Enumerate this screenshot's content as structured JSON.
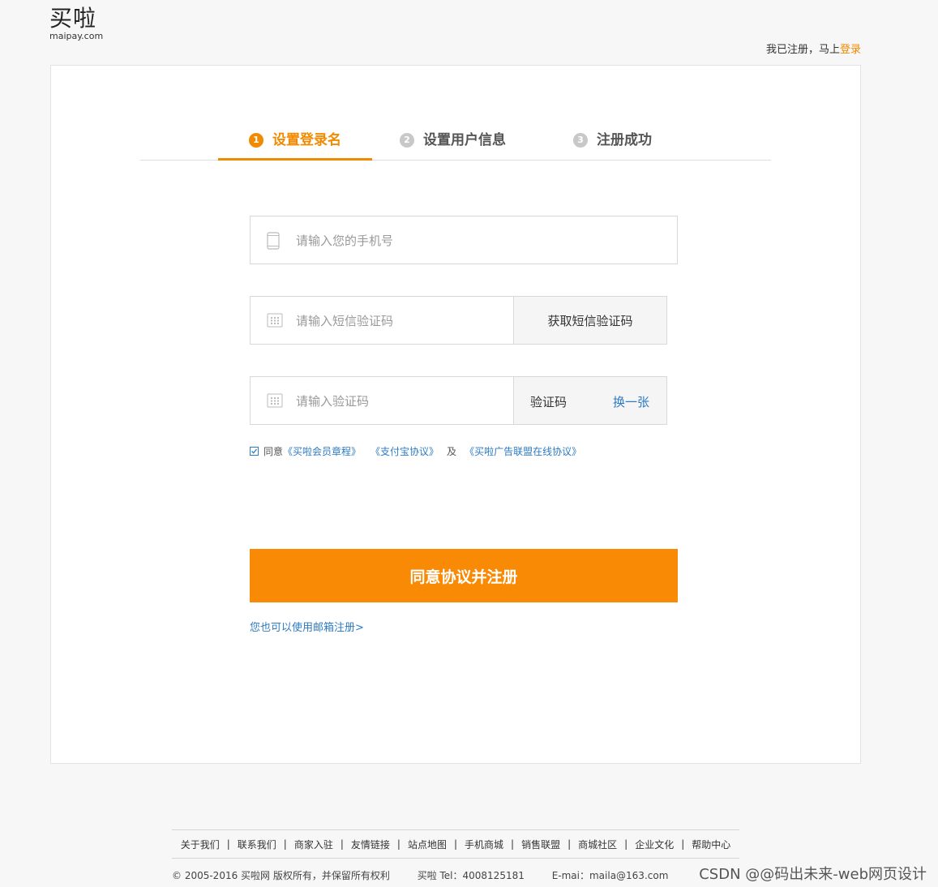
{
  "header": {
    "logo_cn": "买啦",
    "logo_en": "maipay.com",
    "login_prompt": "我已注册，马上",
    "login_link": "登录"
  },
  "steps": [
    {
      "num": "1",
      "label": "设置登录名",
      "active": true
    },
    {
      "num": "2",
      "label": "设置用户信息",
      "active": false
    },
    {
      "num": "3",
      "label": "注册成功",
      "active": false
    }
  ],
  "form": {
    "phone_placeholder": "请输入您的手机号",
    "sms_placeholder": "请输入短信验证码",
    "sms_button": "获取短信验证码",
    "captcha_placeholder": "请输入验证码",
    "captcha_label": "验证码",
    "captcha_refresh": "换一张",
    "agree_prefix": "同意",
    "agree_link1": "《买啦会员章程》",
    "agree_link2": "《支付宝协议》",
    "agree_and": "及",
    "agree_link3": "《买啦广告联盟在线协议》",
    "agree_checked": true,
    "submit_label": "同意协议并注册",
    "email_register": "您也可以使用邮箱注册>"
  },
  "footer": {
    "links": [
      "关于我们",
      "联系我们",
      "商家入驻",
      "友情链接",
      "站点地图",
      "手机商城",
      "销售联盟",
      "商城社区",
      "企业文化",
      "帮助中心"
    ],
    "copyright": "©  2005-2016 买啦网 版权所有，并保留所有权利",
    "tel": "买啦 Tel：4008125181",
    "email": "E-mai：maila@163.com"
  },
  "watermark": "CSDN @@码出未来-web网页设计",
  "colors": {
    "accent": "#f88a05",
    "link": "#2d7bc2",
    "border": "#d8d8d8"
  }
}
